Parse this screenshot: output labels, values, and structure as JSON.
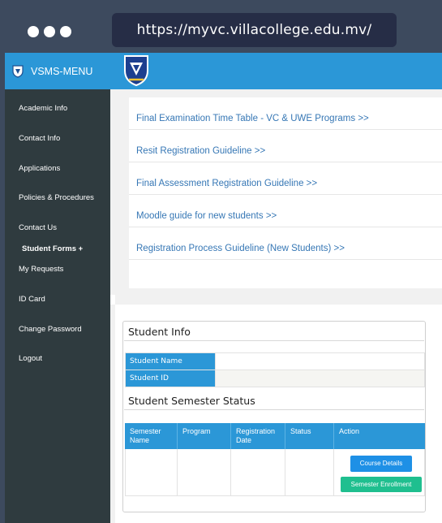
{
  "browser": {
    "url": "https://myvc.villacollege.edu.mv/"
  },
  "menu": {
    "title": "VSMS-MENU",
    "items": [
      "Academic Info",
      "Contact Info",
      "Applications",
      "Policies & Procedures",
      "Contact Us",
      "Student Forms +",
      "My Requests",
      "ID Card",
      "Change Password",
      "Logout"
    ]
  },
  "links": [
    "Final Examination Time Table - VC & UWE Programs >>",
    "Resit Registration Guideline >>",
    "Final Assessment Registration Guideline >>",
    "Moodle guide for new students >>",
    "Registration Process Guideline (New Students) >>"
  ],
  "student_info": {
    "title": "Student Info",
    "name_label": "Student Name",
    "name_value": "",
    "id_label": "Student ID",
    "id_value": ""
  },
  "semester_status": {
    "title": "Student Semester Status",
    "columns": [
      "Semester Name",
      "Program",
      "Registration Date",
      "Status",
      "Action"
    ],
    "course_details_button": "Course Details",
    "semester_enrollment_button": "Semester Enrollment"
  },
  "colors": {
    "primary": "#2b97d7",
    "sidebar": "#2f3b3f",
    "chrome": "#3d4a5e",
    "url_bar": "#262d46",
    "link": "#3677b5",
    "details_button": "#1e90e6",
    "enroll_button": "#1fbf8f"
  }
}
